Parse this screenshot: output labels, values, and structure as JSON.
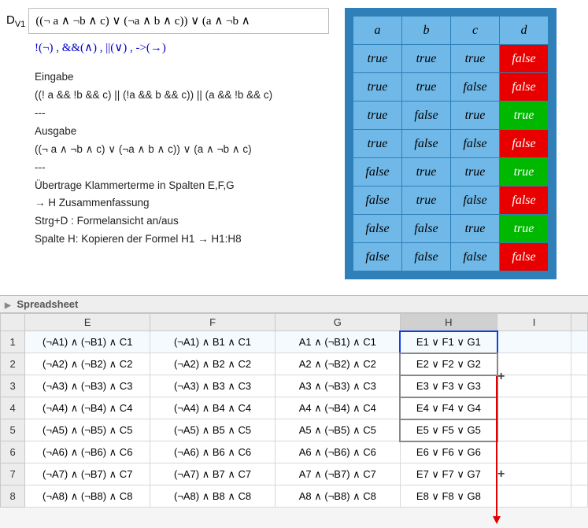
{
  "formula": {
    "var_label": "D",
    "var_sub": "V1",
    "expression": "((¬ a ∧ ¬b ∧ c) ∨ (¬a ∧ b ∧ c)) ∨ (a ∧ ¬b ∧"
  },
  "legend": "!(¬) ,  &&(∧) ,  ||(∨) , ->(→)",
  "notes": {
    "l1": "Eingabe",
    "l2": "((! a && !b && c) || (!a && b && c)) || (a && !b && c)",
    "l3": "---",
    "l4": "Ausgabe",
    "l5": "((¬ a ∧ ¬b ∧ c) ∨ (¬a ∧ b ∧ c)) ∨ (a ∧ ¬b ∧ c)",
    "l6": "---",
    "l7": "Übertrage Klammerterme in Spalten E,F,G",
    "l8": "→ H Zusammenfassung",
    "l9": "Strg+D : Formelansicht an/aus",
    "l10": "Spalte H: Kopieren der Formel H1 → H1:H8"
  },
  "truth_table": {
    "headers": [
      "a",
      "b",
      "c",
      "d"
    ],
    "rows": [
      [
        "true",
        "true",
        "true",
        "false"
      ],
      [
        "true",
        "true",
        "false",
        "false"
      ],
      [
        "true",
        "false",
        "true",
        "true"
      ],
      [
        "true",
        "false",
        "false",
        "false"
      ],
      [
        "false",
        "true",
        "true",
        "true"
      ],
      [
        "false",
        "true",
        "false",
        "false"
      ],
      [
        "false",
        "false",
        "true",
        "true"
      ],
      [
        "false",
        "false",
        "false",
        "false"
      ]
    ]
  },
  "spreadsheet": {
    "title": "Spreadsheet",
    "cols": [
      "E",
      "F",
      "G",
      "H",
      "I"
    ],
    "rows": [
      {
        "n": "1",
        "E": "(¬A1) ∧ (¬B1) ∧ C1",
        "F": "(¬A1) ∧ B1 ∧ C1",
        "G": "A1 ∧ (¬B1) ∧ C1",
        "H": "E1 ∨ F1 ∨ G1",
        "I": ""
      },
      {
        "n": "2",
        "E": "(¬A2) ∧ (¬B2) ∧ C2",
        "F": "(¬A2) ∧ B2 ∧ C2",
        "G": "A2 ∧ (¬B2) ∧ C2",
        "H": "E2 ∨ F2 ∨ G2",
        "I": ""
      },
      {
        "n": "3",
        "E": "(¬A3) ∧ (¬B3) ∧ C3",
        "F": "(¬A3) ∧ B3 ∧ C3",
        "G": "A3 ∧ (¬B3) ∧ C3",
        "H": "E3 ∨ F3 ∨ G3",
        "I": ""
      },
      {
        "n": "4",
        "E": "(¬A4) ∧ (¬B4) ∧ C4",
        "F": "(¬A4) ∧ B4 ∧ C4",
        "G": "A4 ∧ (¬B4) ∧ C4",
        "H": "E4 ∨ F4 ∨ G4",
        "I": ""
      },
      {
        "n": "5",
        "E": "(¬A5) ∧ (¬B5) ∧ C5",
        "F": "(¬A5) ∧ B5 ∧ C5",
        "G": "A5 ∧ (¬B5) ∧ C5",
        "H": "E5 ∨ F5 ∨ G5",
        "I": ""
      },
      {
        "n": "6",
        "E": "(¬A6) ∧ (¬B6) ∧ C6",
        "F": "(¬A6) ∧ B6 ∧ C6",
        "G": "A6 ∧ (¬B6) ∧ C6",
        "H": "E6 ∨ F6 ∨ G6",
        "I": ""
      },
      {
        "n": "7",
        "E": "(¬A7) ∧ (¬B7) ∧ C7",
        "F": "(¬A7) ∧ B7 ∧ C7",
        "G": "A7 ∧ (¬B7) ∧ C7",
        "H": "E7 ∨ F7 ∨ G7",
        "I": ""
      },
      {
        "n": "8",
        "E": "(¬A8) ∧ (¬B8) ∧ C8",
        "F": "(¬A8) ∧ B8 ∧ C8",
        "G": "A8 ∧ (¬B8) ∧ C8",
        "H": "E8 ∨ F8 ∨ G8",
        "I": ""
      }
    ]
  }
}
